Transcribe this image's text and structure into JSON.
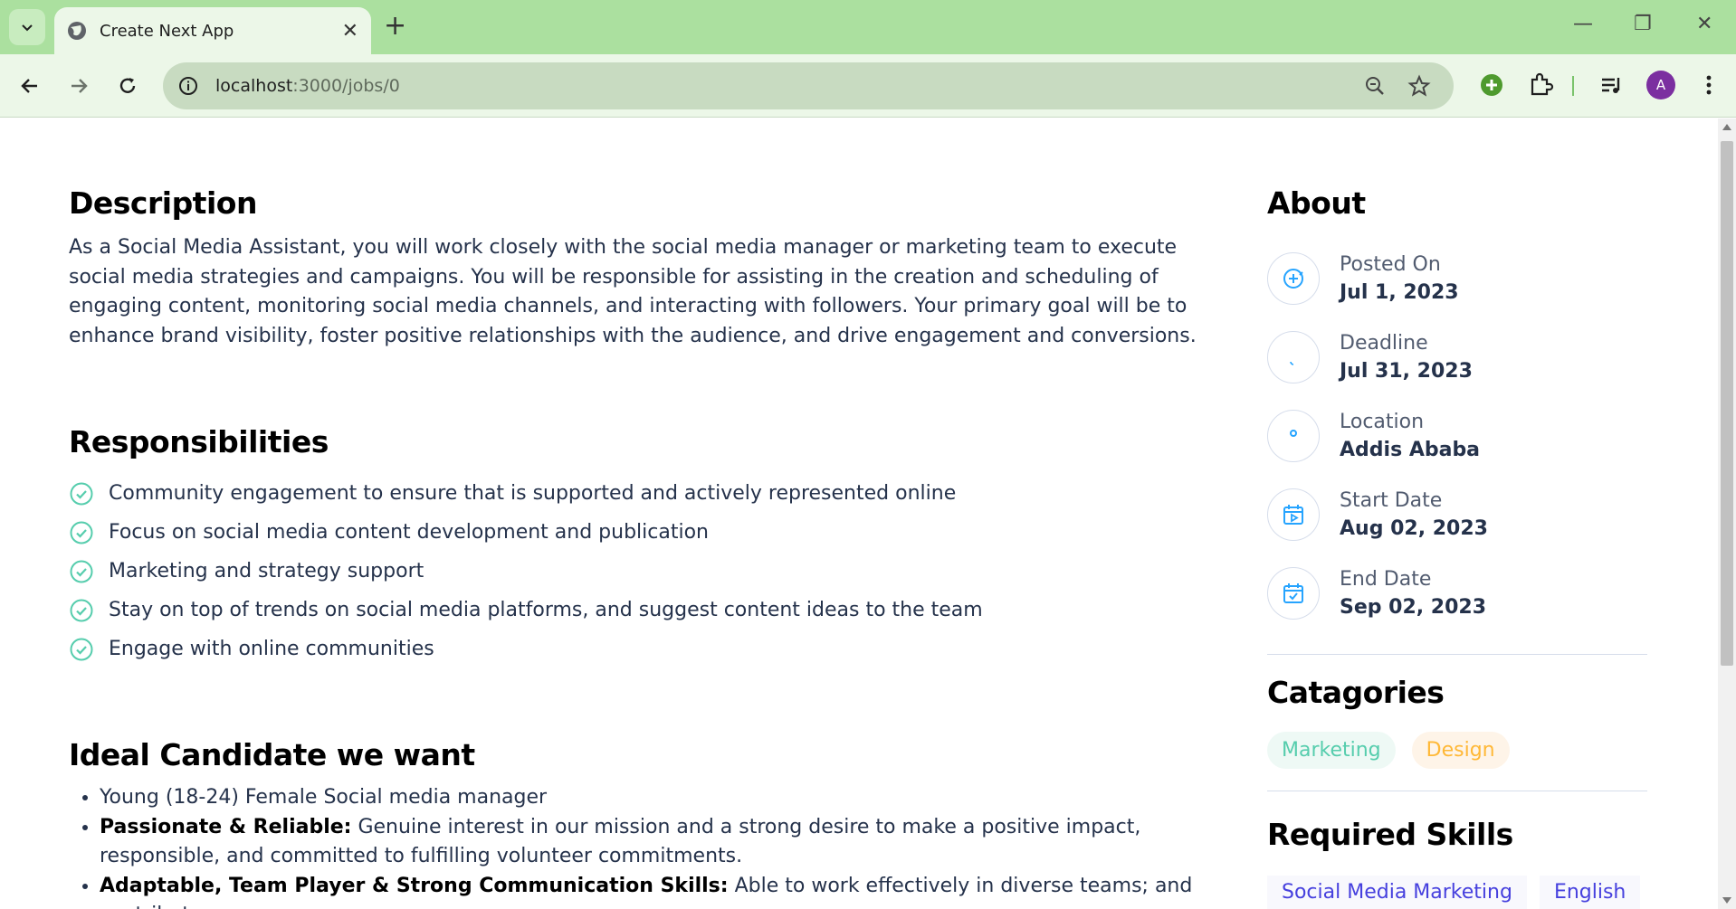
{
  "browser": {
    "tab_title": "Create Next App",
    "url_host": "localhost",
    "url_path": ":3000/jobs/0",
    "profile_initial": "A"
  },
  "colors": {
    "chrome_green": "#abe09f",
    "accent_check": "#56cdad",
    "icon_blue": "#26a4ff",
    "skill_blue": "#4640de"
  },
  "description": {
    "heading": "Description",
    "text": "As a Social Media Assistant, you will work closely with the social media manager or marketing team to execute social media strategies and campaigns. You will be responsible for assisting in the creation and scheduling of engaging content, monitoring social media channels, and interacting with followers. Your primary goal will be to enhance brand visibility, foster positive relationships with the audience, and drive engagement and conversions."
  },
  "responsibilities": {
    "heading": "Responsibilities",
    "items": [
      "Community engagement to ensure that is supported and actively represented online",
      "Focus on social media content development and publication",
      "Marketing and strategy support",
      "Stay on top of trends on social media platforms, and suggest content ideas to the team",
      "Engage with online communities"
    ]
  },
  "ideal": {
    "heading": "Ideal Candidate we want",
    "items": [
      {
        "bold": "",
        "text": "Young (18-24) Female Social media manager"
      },
      {
        "bold": "Passionate & Reliable:",
        "text": " Genuine interest in our mission and a strong desire to make a positive impact, responsible, and committed to fulfilling volunteer commitments."
      },
      {
        "bold": "Adaptable, Team Player & Strong Communication Skills:",
        "text": " Able to work effectively in diverse teams; and contributes"
      }
    ]
  },
  "about": {
    "heading": "About",
    "items": [
      {
        "label": "Posted On",
        "value": "Jul 1, 2023",
        "icon": "plus-circle-icon"
      },
      {
        "label": "Deadline",
        "value": "Jul 31, 2023",
        "icon": "fire-icon"
      },
      {
        "label": "Location",
        "value": "Addis Ababa",
        "icon": "location-pin-icon"
      },
      {
        "label": "Start Date",
        "value": "Aug 02, 2023",
        "icon": "calendar-play-icon"
      },
      {
        "label": "End Date",
        "value": "Sep 02, 2023",
        "icon": "calendar-check-icon"
      }
    ]
  },
  "categories": {
    "heading": "Catagories",
    "items": [
      "Marketing",
      "Design"
    ]
  },
  "skills": {
    "heading": "Required Skills",
    "items": [
      "Social Media Marketing",
      "English"
    ]
  }
}
